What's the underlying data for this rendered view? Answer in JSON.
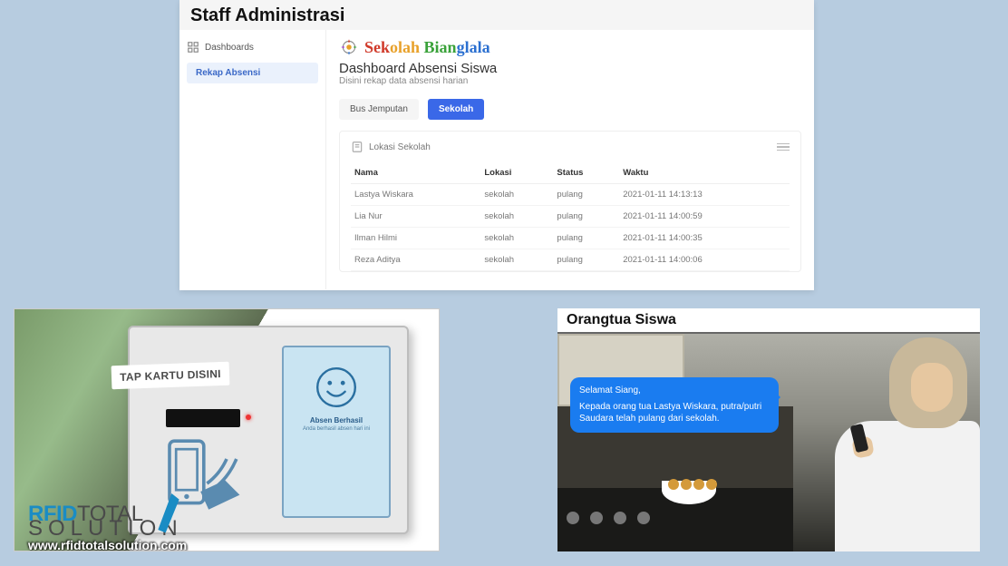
{
  "dashboard": {
    "title": "Staff Administrasi",
    "sidebar": {
      "section": "Dashboards",
      "items": [
        "Rekap Absensi"
      ]
    },
    "brand": "Sekolah Bianglala",
    "page_title": "Dashboard Absensi Siswa",
    "page_sub": "Disini rekap data absensi harian",
    "tabs": [
      {
        "label": "Bus Jemputan",
        "active": false
      },
      {
        "label": "Sekolah",
        "active": true
      }
    ],
    "card_title": "Lokasi Sekolah",
    "columns": [
      "Nama",
      "Lokasi",
      "Status",
      "Waktu"
    ],
    "rows": [
      {
        "nama": "Lastya Wiskara",
        "lokasi": "sekolah",
        "status": "pulang",
        "waktu": "2021-01-11 14:13:13"
      },
      {
        "nama": "Lia Nur",
        "lokasi": "sekolah",
        "status": "pulang",
        "waktu": "2021-01-11 14:00:59"
      },
      {
        "nama": "Ilman Hilmi",
        "lokasi": "sekolah",
        "status": "pulang",
        "waktu": "2021-01-11 14:00:35"
      },
      {
        "nama": "Reza Aditya",
        "lokasi": "sekolah",
        "status": "pulang",
        "waktu": "2021-01-11 14:00:06"
      }
    ]
  },
  "device": {
    "tap_label": "TAP KARTU DISINI",
    "screen_line1": "Absen Berhasil",
    "screen_line2": "Anda berhasil absen hari ini",
    "brand_1": "RFID",
    "brand_2": "TOTAL",
    "brand_3": "SOLUTION",
    "url": "www.rfidtotalsolution.com"
  },
  "parent": {
    "title": "Orangtua Siswa",
    "msg_line1": "Selamat Siang,",
    "msg_line2": "Kepada orang tua Lastya Wiskara, putra/putri Saudara telah pulang dari sekolah."
  }
}
